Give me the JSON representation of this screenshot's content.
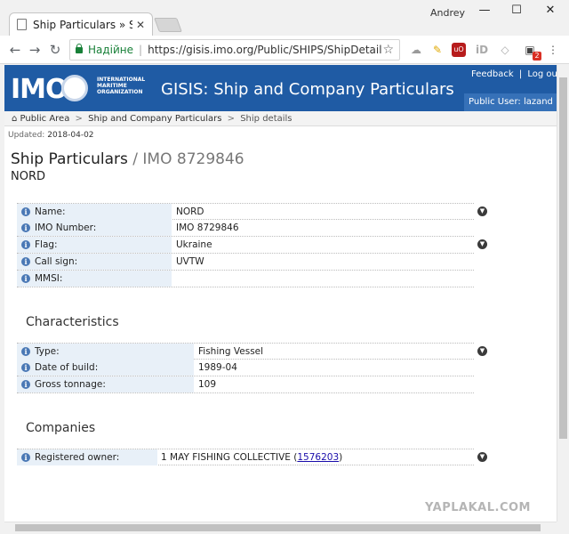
{
  "browser": {
    "tab_title": "Ship Particulars » Ship de",
    "tab_close": "✕",
    "user": "Andrey",
    "controls": {
      "minimize": "—",
      "maximize": "☐",
      "close": "✕"
    },
    "nav": {
      "back": "←",
      "forward": "→",
      "reload": "↻"
    },
    "secure_label": "Надійне",
    "separator": "|",
    "url": "https://gisis.imo.org/Public/SHIPS/ShipDetails.asp...",
    "star": "☆",
    "extensions": [
      "cloud-icon",
      "pin-icon",
      "ublock-icon",
      "id-icon",
      "shield-icon",
      "ext-icon",
      "menu-icon"
    ],
    "ext_badge": "2"
  },
  "header": {
    "logo_text": "IMO",
    "org_line1": "INTERNATIONAL",
    "org_line2": "MARITIME",
    "org_line3": "ORGANIZATION",
    "title": "GISIS: Ship and Company Particulars",
    "feedback": "Feedback",
    "divider": "|",
    "logout": "Log out",
    "public_user": "Public User: lazand"
  },
  "breadcrumb": {
    "home": "⌂",
    "items": [
      "Public Area",
      "Ship and Company Particulars",
      "Ship details"
    ],
    "sep": ">"
  },
  "updated": {
    "label": "Updated:",
    "date": "2018-04-02"
  },
  "page": {
    "title": "Ship Particulars",
    "slash": "/",
    "imo": "IMO 8729846",
    "ship_name": "NORD"
  },
  "particulars": [
    {
      "label": "Name:",
      "value": "NORD"
    },
    {
      "label": "IMO Number:",
      "value": "IMO 8729846"
    },
    {
      "label": "Flag:",
      "value": "Ukraine"
    },
    {
      "label": "Call sign:",
      "value": "UVTW"
    },
    {
      "label": "MMSI:",
      "value": ""
    }
  ],
  "characteristics": {
    "title": "Characteristics",
    "rows": [
      {
        "label": "Type:",
        "value": "Fishing Vessel"
      },
      {
        "label": "Date of build:",
        "value": "1989-04"
      },
      {
        "label": "Gross tonnage:",
        "value": "109"
      }
    ]
  },
  "companies": {
    "title": "Companies",
    "rows": [
      {
        "label": "Registered owner:",
        "value": "1 MAY FISHING COLLECTIVE",
        "open": "(",
        "link": "1576203",
        "close": ")"
      }
    ]
  },
  "watermark": "YAPLAKAL.COM",
  "colors": {
    "banner": "#1f5ba4",
    "label_bg": "#e8f0f8",
    "secure": "#188038"
  }
}
